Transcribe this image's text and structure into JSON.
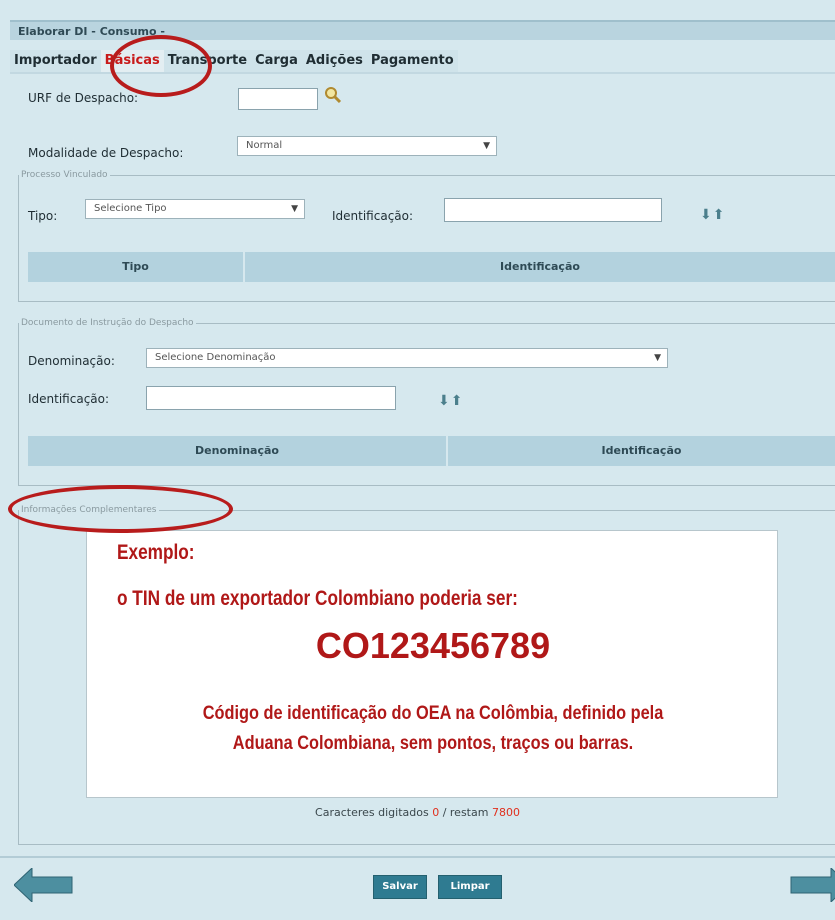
{
  "window": {
    "title": "Elaborar DI - Consumo -"
  },
  "tabs": [
    {
      "label": "Importador"
    },
    {
      "label": "Básicas",
      "active": true
    },
    {
      "label": "Transporte"
    },
    {
      "label": "Carga"
    },
    {
      "label": "Adições"
    },
    {
      "label": "Pagamento"
    }
  ],
  "form": {
    "urf_label": "URF de Despacho:",
    "urf_value": "",
    "modalidade_label": "Modalidade de Despacho:",
    "modalidade_value": "Normal"
  },
  "processo": {
    "legend": "Processo Vinculado",
    "tipo_label": "Tipo:",
    "tipo_value": "Selecione Tipo",
    "ident_label": "Identificação:",
    "ident_value": "",
    "col_tipo": "Tipo",
    "col_ident": "Identificação"
  },
  "documento": {
    "legend": "Documento de Instrução do Despacho",
    "denominacao_label": "Denominação:",
    "denominacao_value": "Selecione Denominação",
    "ident_label": "Identificação:",
    "ident_value": "",
    "col_denominacao": "Denominação",
    "col_ident": "Identificação"
  },
  "informacoes": {
    "legend": "Informações Complementares",
    "note_heading": "Exemplo:",
    "note_line": "o TIN de um exportador Colombiano poderia ser:",
    "note_code": "CO123456789",
    "note_desc_1": "Código de identificação do OEA na Colômbia, definido pela",
    "note_desc_2": "Aduana Colombiana, sem pontos, traços ou barras."
  },
  "counter": {
    "prefix": "Caracteres digitados",
    "typed": "0",
    "sep": "/ restam",
    "remaining": "7800"
  },
  "buttons": {
    "save": "Salvar",
    "clear": "Limpar"
  },
  "colors": {
    "accent": "#2f7b91",
    "highlight": "#b81c1c",
    "background": "#d6e8ee"
  },
  "icons": [
    "search-icon",
    "arrow-down-icon",
    "arrow-up-icon",
    "back-arrow-icon",
    "forward-arrow-icon"
  ]
}
